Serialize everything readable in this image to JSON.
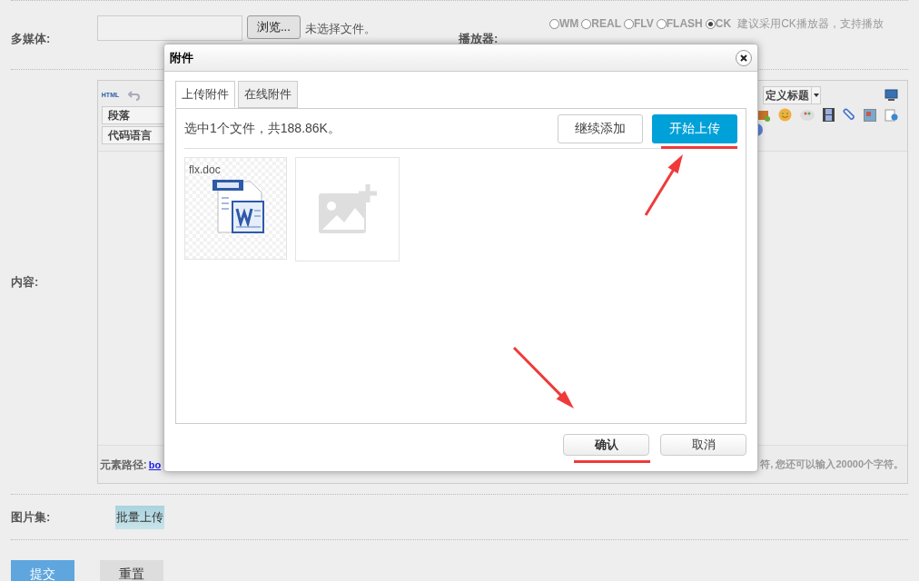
{
  "form": {
    "multimedia": {
      "label": "多媒体:",
      "browse_button": "浏览...",
      "file_status": "未选择文件。"
    },
    "player": {
      "label": "播放器:",
      "options": [
        {
          "label": "WM",
          "selected": false
        },
        {
          "label": "REAL",
          "selected": false
        },
        {
          "label": "FLV",
          "selected": false
        },
        {
          "label": "FLASH",
          "selected": false
        },
        {
          "label": "CK",
          "selected": true
        }
      ],
      "hint": "建议采用CK播放器，支持播放"
    },
    "content": {
      "label": "内容:",
      "toolbar": {
        "html_label": "HTML",
        "selects": [
          "段落",
          "代码语言"
        ],
        "heading_select": "定义标题"
      },
      "status_path_label": "元素路径:",
      "status_path_link": "bo",
      "char_count": "符, 您还可以输入20000个字符。"
    },
    "gallery": {
      "label": "图片集:",
      "button": "批量上传"
    },
    "buttons": [
      {
        "label": "提交",
        "kind": "primary"
      },
      {
        "label": "重置",
        "kind": "secondary"
      }
    ]
  },
  "dialog": {
    "title": "附件",
    "tabs": [
      {
        "label": "上传附件",
        "selected": true
      },
      {
        "label": "在线附件",
        "selected": false
      }
    ],
    "summary": "选中1个文件，共188.86K。",
    "add_button": "继续添加",
    "upload_button": "开始上传",
    "files": [
      {
        "name": "flx.doc"
      }
    ],
    "footer_buttons": [
      {
        "label": "确认",
        "kind": "confirm"
      },
      {
        "label": "取消",
        "kind": "cancel"
      }
    ]
  }
}
